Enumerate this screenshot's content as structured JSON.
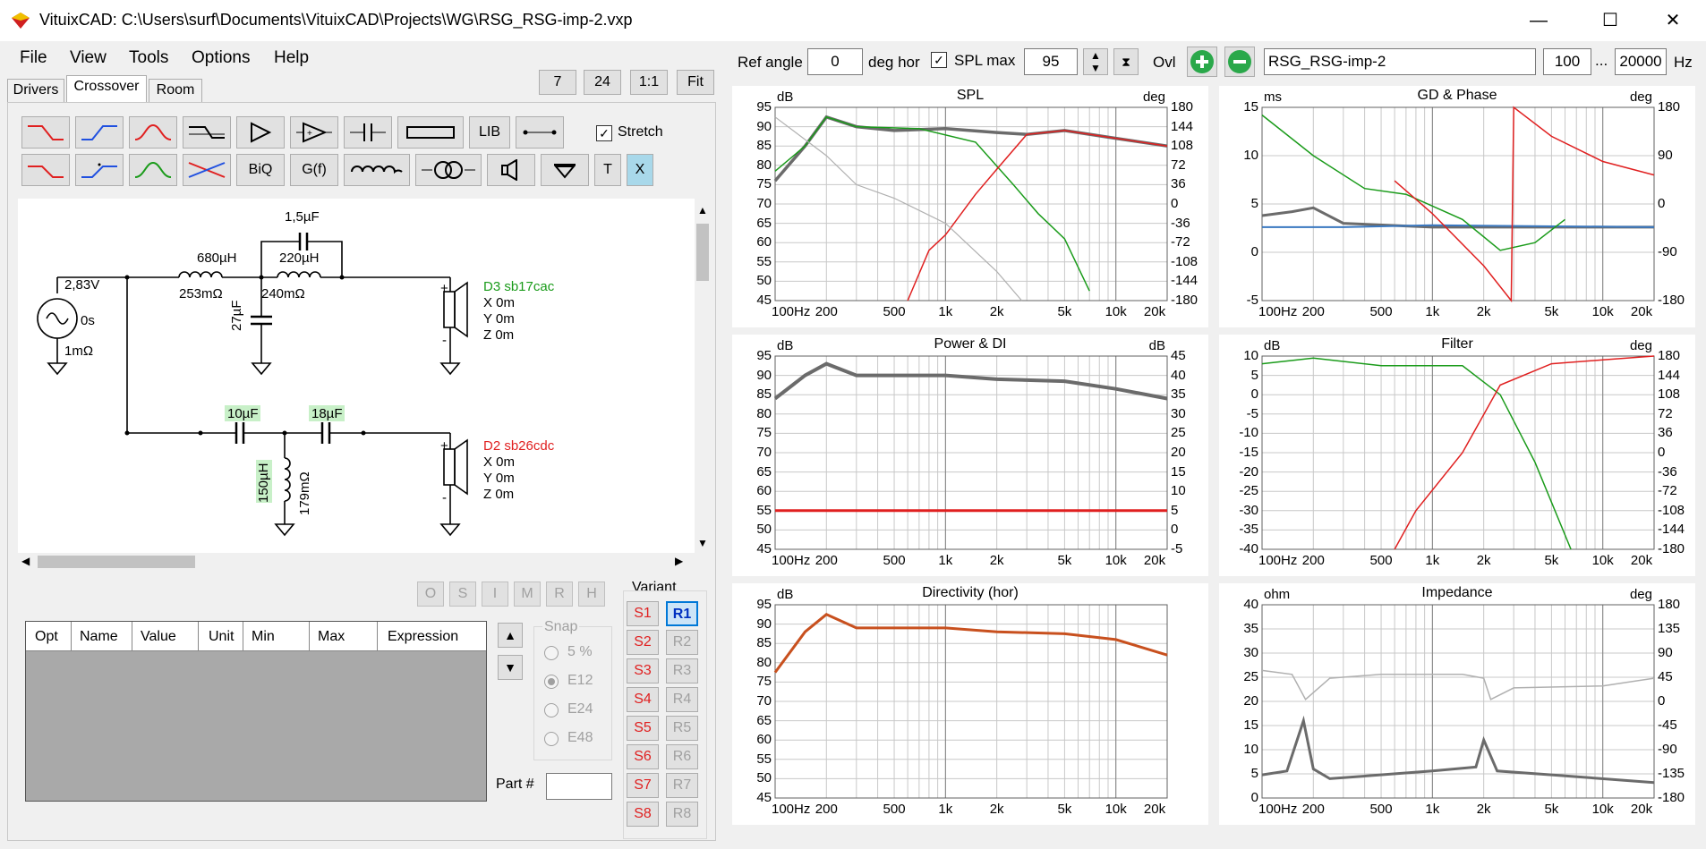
{
  "window": {
    "title": "VituixCAD: C:\\Users\\surf\\Documents\\VituixCAD\\Projects\\WG\\RSG_RSG-imp-2.vxp"
  },
  "menu": [
    "File",
    "View",
    "Tools",
    "Options",
    "Help"
  ],
  "tabs": [
    "Drivers",
    "Crossover",
    "Room"
  ],
  "top_buttons": [
    "7",
    "24",
    "1:1",
    "Fit"
  ],
  "toolbar": {
    "lib": "LIB",
    "biq": "BiQ",
    "gf": "G(f)",
    "t": "T",
    "x": "X",
    "stretch": "Stretch"
  },
  "schematic": {
    "source_v": "2,83V",
    "source_t": "0s",
    "source_r": "1mΩ",
    "l1": "680µH",
    "l1_r": "253mΩ",
    "c_par": "1,5µF",
    "l2": "220µH",
    "l2_r": "240mΩ",
    "c_shunt": "27µF",
    "c1": "10µF",
    "c2": "18µF",
    "l3": "150µH",
    "l3_r": "179mΩ",
    "d3_name": "D3 sb17cac",
    "d3_x": "X 0m",
    "d3_y": "Y 0m",
    "d3_z": "Z 0m",
    "d2_name": "D2 sb26cdc",
    "d2_x": "X 0m",
    "d2_y": "Y 0m",
    "d2_z": "Z 0m",
    "plus": "+",
    "minus": "-"
  },
  "grid_buttons": [
    "O",
    "S",
    "I",
    "M",
    "R",
    "H"
  ],
  "table_headers": [
    "Opt",
    "Name",
    "Value",
    "Unit",
    "Min",
    "Max",
    "Expression"
  ],
  "snap": {
    "label": "Snap",
    "options": [
      "5 %",
      "E12",
      "E24",
      "E48"
    ],
    "selected": "E12"
  },
  "part_label": "Part #",
  "variant": {
    "label": "Variant",
    "s": [
      "S1",
      "S2",
      "S3",
      "S4",
      "S5",
      "S6",
      "S7",
      "S8"
    ],
    "r": [
      "R1",
      "R2",
      "R3",
      "R4",
      "R5",
      "R6",
      "R7",
      "R8"
    ]
  },
  "topbar": {
    "ref_angle_label": "Ref angle",
    "ref_angle": "0",
    "deg_hor": "deg hor",
    "splmax_label": "SPL max",
    "splmax": "95",
    "ovl": "Ovl",
    "name": "RSG_RSG-imp-2",
    "fmin": "100",
    "dots": "...",
    "fmax": "20000",
    "hz": "Hz"
  },
  "colors": {
    "green": "#1a9b1a",
    "red": "#e02020",
    "gray": "#6b6b6b",
    "lightgray": "#b0b0b0",
    "blue": "#3a78c0",
    "orange": "#c8501e"
  },
  "graphs": [
    {
      "title": "SPL",
      "left_unit": "dB",
      "right_unit": "deg",
      "left_ticks": [
        "95",
        "90",
        "85",
        "80",
        "75",
        "70",
        "65",
        "60",
        "55",
        "50",
        "45"
      ],
      "right_ticks": [
        "180",
        "144",
        "108",
        "72",
        "36",
        "0",
        "-36",
        "-72",
        "-108",
        "-144",
        "-180"
      ]
    },
    {
      "title": "GD & Phase",
      "left_unit": "ms",
      "right_unit": "deg",
      "left_ticks": [
        "15",
        "10",
        "5",
        "0",
        "-5"
      ],
      "right_ticks": [
        "180",
        "90",
        "0",
        "-90",
        "-180"
      ]
    },
    {
      "title": "Power & DI",
      "left_unit": "dB",
      "right_unit": "dB",
      "left_ticks": [
        "95",
        "90",
        "85",
        "80",
        "75",
        "70",
        "65",
        "60",
        "55",
        "50",
        "45"
      ],
      "right_ticks": [
        "45",
        "40",
        "35",
        "30",
        "25",
        "20",
        "15",
        "10",
        "5",
        "0",
        "-5"
      ]
    },
    {
      "title": "Filter",
      "left_unit": "dB",
      "right_unit": "deg",
      "left_ticks": [
        "10",
        "5",
        "0",
        "-5",
        "-10",
        "-15",
        "-20",
        "-25",
        "-30",
        "-35",
        "-40"
      ],
      "right_ticks": [
        "180",
        "144",
        "108",
        "72",
        "36",
        "0",
        "-36",
        "-72",
        "-108",
        "-144",
        "-180"
      ]
    },
    {
      "title": "Directivity (hor)",
      "left_unit": "dB",
      "right_unit": "",
      "left_ticks": [
        "95",
        "90",
        "85",
        "80",
        "75",
        "70",
        "65",
        "60",
        "55",
        "50",
        "45"
      ],
      "right_ticks": []
    },
    {
      "title": "Impedance",
      "left_unit": "ohm",
      "right_unit": "deg",
      "left_ticks": [
        "40",
        "35",
        "30",
        "25",
        "20",
        "15",
        "10",
        "5",
        "0"
      ],
      "right_ticks": [
        "180",
        "135",
        "90",
        "45",
        "0",
        "-45",
        "-90",
        "-135",
        "-180"
      ]
    }
  ],
  "x_ticks": [
    "100Hz",
    "200",
    "500",
    "1k",
    "2k",
    "5k",
    "10k",
    "20k"
  ]
}
